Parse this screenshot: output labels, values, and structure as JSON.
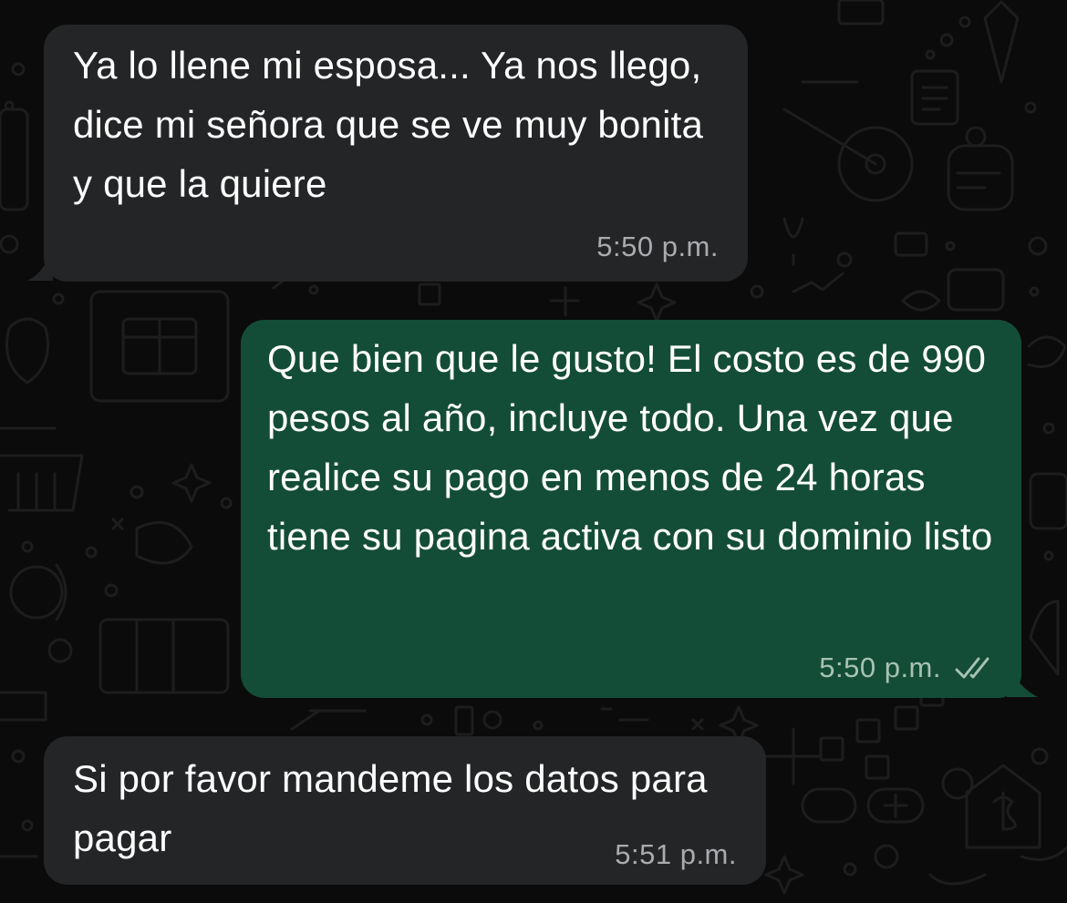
{
  "messages": [
    {
      "direction": "incoming",
      "text": "Ya lo llene mi esposa... Ya nos llego, dice mi señora que se ve muy bonita y que la quiere",
      "time": "5:50 p.m."
    },
    {
      "direction": "outgoing",
      "text": "Que bien que le gusto! El costo es de 990 pesos al año, incluye todo. Una vez que realice su pago en menos de 24 horas tiene su pagina activa con su dominio listo",
      "time": "5:50 p.m.",
      "status_icon": "double-check-icon"
    },
    {
      "direction": "incoming",
      "text": "Si por favor mandeme los datos para pagar",
      "time": "5:51 p.m."
    }
  ],
  "colors": {
    "background": "#0b0b0b",
    "incoming_bubble": "#242526",
    "outgoing_bubble": "#144d37",
    "text": "#ffffff",
    "timestamp_incoming": "#a9acaf",
    "timestamp_outgoing": "#a6c2b4"
  }
}
